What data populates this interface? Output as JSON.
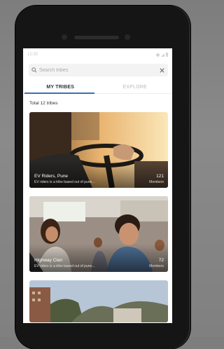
{
  "status_bar": {
    "time": "12:30"
  },
  "search": {
    "placeholder": "Search tribes",
    "clear_icon": "close-icon"
  },
  "tabs": [
    {
      "label": "MY TRIBES",
      "active": true
    },
    {
      "label": "EXPLORE",
      "active": false
    }
  ],
  "total_label": "Total 12 tribes",
  "tribes": [
    {
      "name": "EV Riders, Pune",
      "description": "EV riders is a tribe based out of pune...",
      "count": "121",
      "count_label": "Members"
    },
    {
      "name": "Highway Clan",
      "description": "EV riders is a tribe based out of pune...",
      "count": "72",
      "count_label": "Members"
    }
  ],
  "colors": {
    "accent": "#3d6fb5",
    "phone_body": "#151515",
    "background": "#808080"
  }
}
